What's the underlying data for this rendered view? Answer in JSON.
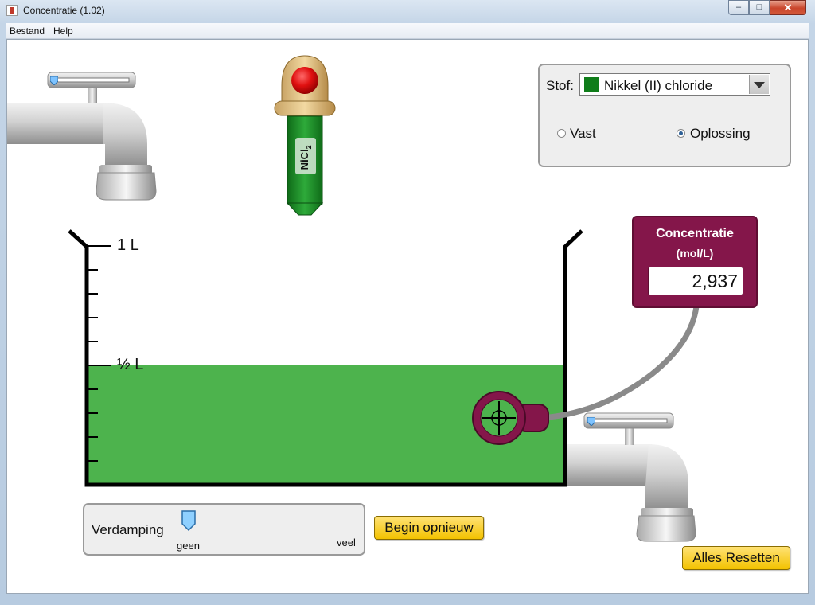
{
  "window": {
    "title": "Concentratie (1.02)",
    "minimize_glyph": "–",
    "maximize_glyph": "□",
    "close_glyph": "✕"
  },
  "menu": [
    "Bestand",
    "Help"
  ],
  "solute_panel": {
    "label": "Stof:",
    "selected_solute": "Nikkel (II) chloride",
    "selected_color": "#0f7d1a",
    "form_options": [
      {
        "label": "Vast",
        "selected": false
      },
      {
        "label": "Oplossing",
        "selected": true
      }
    ]
  },
  "dropper": {
    "label_main": "NiCl",
    "label_sub": "2",
    "button_color": "#e01010",
    "tube_color": "#1b8b25"
  },
  "beaker": {
    "mark_top": "1 L",
    "mark_half": "½ L",
    "solution_fraction": 0.5,
    "solution_color": "#4db34d"
  },
  "meter": {
    "title": "Concentratie",
    "unit": "(mol/L)",
    "value": "2,937",
    "color": "#84164a"
  },
  "input_faucet": {
    "flow_fraction": 0.0
  },
  "drain_faucet": {
    "flow_fraction": 0.0
  },
  "evaporation": {
    "label": "Verdamping",
    "min_label": "geen",
    "max_label": "veel",
    "value_fraction": 0.0
  },
  "buttons": {
    "reset_solution": "Begin opnieuw",
    "reset_all": "Alles Resetten"
  }
}
